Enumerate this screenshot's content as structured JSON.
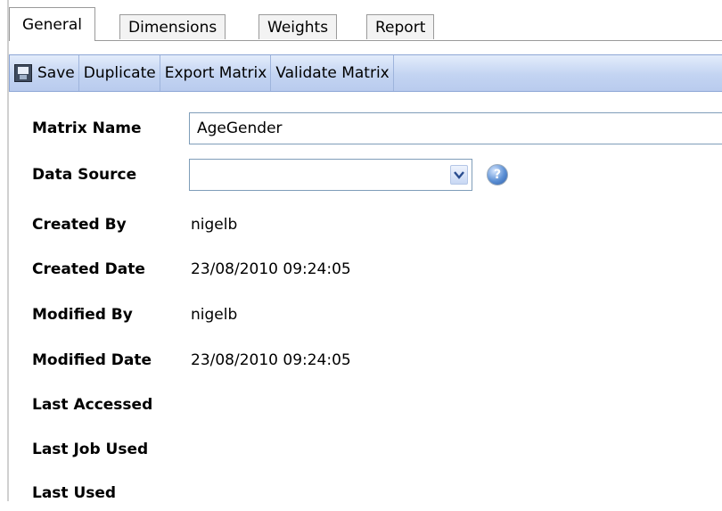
{
  "tabs": [
    {
      "label": "General",
      "active": true
    },
    {
      "label": "Dimensions",
      "active": false
    },
    {
      "label": "Weights",
      "active": false
    },
    {
      "label": "Report",
      "active": false
    }
  ],
  "toolbar": {
    "save_label": "Save",
    "duplicate_label": "Duplicate",
    "export_label": "Export Matrix",
    "validate_label": "Validate Matrix"
  },
  "form": {
    "matrix_name": {
      "label": "Matrix Name",
      "value": "AgeGender"
    },
    "data_source": {
      "label": "Data Source",
      "value": "",
      "help_icon": "?"
    },
    "created_by": {
      "label": "Created By",
      "value": "nigelb"
    },
    "created_date": {
      "label": "Created Date",
      "value": "23/08/2010 09:24:05"
    },
    "modified_by": {
      "label": "Modified By",
      "value": "nigelb"
    },
    "modified_date": {
      "label": "Modified Date",
      "value": "23/08/2010 09:24:05"
    },
    "last_accessed": {
      "label": "Last Accessed",
      "value": ""
    },
    "last_job_used": {
      "label": "Last Job Used",
      "value": ""
    },
    "last_used": {
      "label": "Last Used",
      "value": ""
    }
  },
  "icons": {
    "save": "floppy-disk-icon",
    "dropdown": "chevron-down-icon",
    "help": "help-icon"
  },
  "colors": {
    "toolbar_top": "#e3ecfb",
    "toolbar_bottom": "#b9cbee",
    "input_border": "#7f9db9"
  }
}
